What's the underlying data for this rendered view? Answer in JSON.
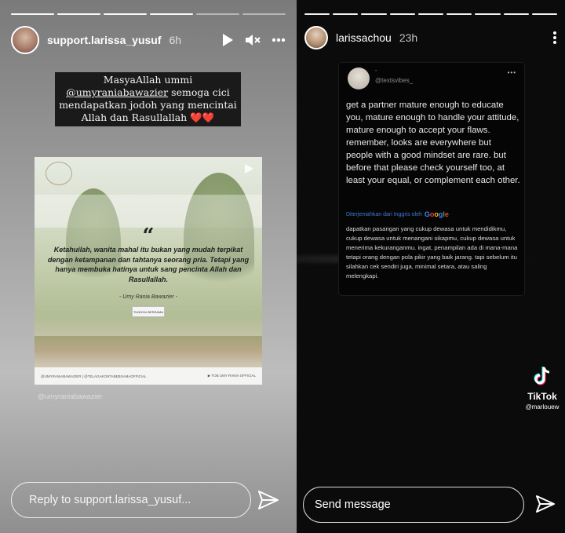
{
  "left_story": {
    "progress_segments": 6,
    "progress_done": 4,
    "username": "support.larissa_yusuf",
    "time": "6h",
    "icons": [
      "play-icon",
      "mute-icon",
      "more-icon"
    ],
    "caption_line1": "MasyaAllah ummi",
    "caption_mention": "@umyraniabawazier",
    "caption_line2": "semoga cici mendapatkan jodoh yang mencintai Allah dan Rasullallah",
    "caption_emoji": "❤️❤️",
    "post": {
      "quote_mark": "“",
      "quote": "Ketahuilah, wanita mahal itu bukan yang mudah terpikat dengan ketampanan dan tahtanya seorang pria. Tetapi yang hanya membuka hatinya untuk sang pencinta Allah dan Rasullallah.",
      "attribution": "- Umy Rania Bawazier -",
      "badge": "TUNGGU BERSAMA",
      "footer_left": "@UMYRANIABAWAZIER | @TELAGAKONTABEBSAMAOFFICIAL",
      "footer_right": "▶ TOB UMY RANIA OFFICIAL"
    },
    "mention_tag": "@umyraniabawazier",
    "reply_placeholder": "Reply to support.larissa_yusuf..."
  },
  "right_story": {
    "progress_segments": 9,
    "progress_done": 9,
    "username": "larissachou",
    "time": "23h",
    "tweet": {
      "name": "-",
      "handle": "@textsvibes_",
      "more": "•••",
      "text": "get a partner mature enough to educate you, mature enough to handle your attitude, mature enough to accept your flaws. remember, looks are everywhere but people with a good mindset are rare. but before that please check yourself too, at least your equal, or complement each other.",
      "translated_label": "Diterjemahkan dari Inggris oleh",
      "google": "Google",
      "translation": "dapatkan pasangan yang cukup dewasa untuk mendidikmu, cukup dewasa untuk menangani sikapmu, cukup dewasa untuk menerima kekuranganmu. ingat, penampilan ada di mana-mana tetapi orang dengan pola pikir yang baik jarang. tapi sebelum itu silahkan cek sendiri juga, minimal setara, atau saling melengkapi."
    },
    "tiktok": {
      "brand": "TikTok",
      "user": "@marlouew"
    },
    "message_placeholder": "Send message"
  }
}
